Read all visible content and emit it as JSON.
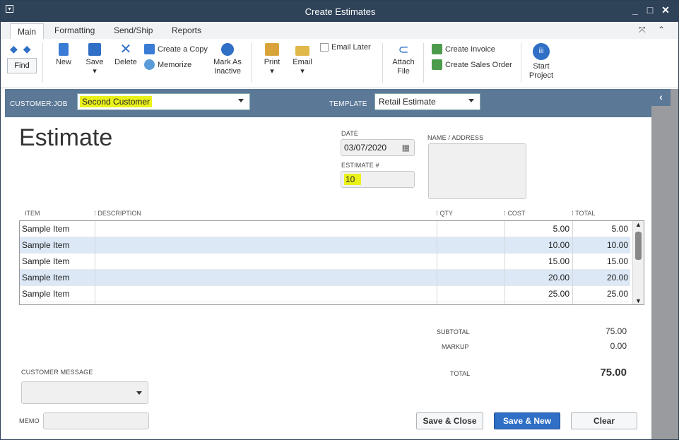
{
  "window": {
    "title": "Create Estimates"
  },
  "tabs": {
    "items": [
      "Main",
      "Formatting",
      "Send/Ship",
      "Reports"
    ],
    "active": "Main"
  },
  "ribbon": {
    "find": "Find",
    "new": "New",
    "save": "Save",
    "delete": "Delete",
    "create_copy": "Create a Copy",
    "memorize": "Memorize",
    "mark_inactive": "Mark As",
    "mark_inactive2": "Inactive",
    "print": "Print",
    "email": "Email",
    "email_later": "Email Later",
    "attach": "Attach",
    "attach2": "File",
    "create_invoice": "Create Invoice",
    "create_sales_order": "Create Sales Order",
    "start_project": "Start",
    "start_project2": "Project"
  },
  "customer_bar": {
    "customer_job_label": "CUSTOMER:JOB",
    "customer_job_value": "Second Customer",
    "template_label": "TEMPLATE",
    "template_value": "Retail Estimate"
  },
  "form": {
    "heading": "Estimate",
    "date_label": "DATE",
    "date_value": "03/07/2020",
    "estimate_no_label": "ESTIMATE #",
    "estimate_no_value": "10",
    "name_address_label": "NAME / ADDRESS"
  },
  "grid": {
    "columns": [
      "ITEM",
      "DESCRIPTION",
      "QTY",
      "COST",
      "TOTAL"
    ],
    "rows": [
      {
        "item": "Sample Item",
        "description": "",
        "qty": "",
        "cost": "5.00",
        "total": "5.00"
      },
      {
        "item": "Sample Item",
        "description": "",
        "qty": "",
        "cost": "10.00",
        "total": "10.00"
      },
      {
        "item": "Sample Item",
        "description": "",
        "qty": "",
        "cost": "15.00",
        "total": "15.00"
      },
      {
        "item": "Sample Item",
        "description": "",
        "qty": "",
        "cost": "20.00",
        "total": "20.00"
      },
      {
        "item": "Sample Item",
        "description": "",
        "qty": "",
        "cost": "25.00",
        "total": "25.00"
      }
    ]
  },
  "totals": {
    "subtotal_label": "SUBTOTAL",
    "subtotal": "75.00",
    "markup_label": "MARKUP",
    "markup": "0.00",
    "total_label": "TOTAL",
    "total": "75.00"
  },
  "footer": {
    "customer_message_label": "CUSTOMER MESSAGE",
    "memo_label": "MEMO",
    "save_close": "Save & Close",
    "save_new": "Save & New",
    "clear": "Clear"
  },
  "colors": {
    "titlebar": "#2e4258",
    "customer_bar": "#5b7896",
    "highlight": "#eaf21a",
    "primary_button": "#2f6fc5",
    "alt_row": "#dce8f6"
  }
}
